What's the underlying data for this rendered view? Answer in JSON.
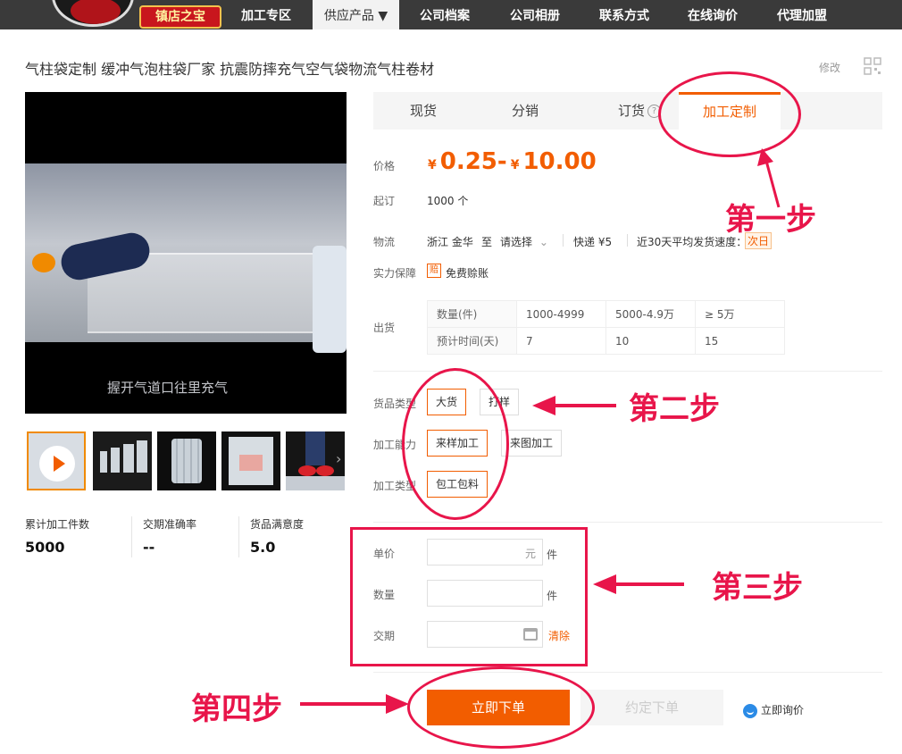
{
  "nav": {
    "badge": "镇店之宝",
    "items": [
      "加工专区",
      "供应产品 ▼",
      "公司档案",
      "公司相册",
      "联系方式",
      "在线询价",
      "代理加盟"
    ]
  },
  "product": {
    "title": "气柱袋定制 缓冲气泡柱袋厂家 抗震防摔充气空气袋物流气柱卷材",
    "edit": "修改",
    "video_caption": "握开气道口往里充气"
  },
  "stats": [
    {
      "label": "累计加工件数",
      "value": "5000"
    },
    {
      "label": "交期准确率",
      "value": "--"
    },
    {
      "label": "货品满意度",
      "value": "5.0"
    }
  ],
  "tabs": [
    "现货",
    "分销",
    "订货",
    "加工定制"
  ],
  "price": {
    "label": "价格",
    "low_sym": "¥",
    "low": "0.25",
    "dash": "-",
    "high_sym": "¥",
    "high": "10.00"
  },
  "moq": {
    "label": "起订",
    "value": "1000 个"
  },
  "logistics": {
    "label": "物流",
    "origin": "浙江 金华",
    "to": "至",
    "select": "请选择",
    "express": "快递 ¥5",
    "speed_label": "近30天平均发货速度：",
    "speed": "次日"
  },
  "guarantee": {
    "label": "实力保障",
    "icon_text": "赔",
    "text": "免费赊账"
  },
  "shipping": {
    "label": "出货",
    "rows": [
      [
        "数量(件)",
        "1000-4999",
        "5000-4.9万",
        "≥ 5万"
      ],
      [
        "预计时间(天)",
        "7",
        "10",
        "15"
      ]
    ]
  },
  "options": {
    "goods_type": {
      "label": "货品类型",
      "items": [
        "大货",
        "打样"
      ]
    },
    "capability": {
      "label": "加工能力",
      "items": [
        "来样加工",
        "来图加工"
      ]
    },
    "proc_type": {
      "label": "加工类型",
      "items": [
        "包工包料"
      ]
    }
  },
  "form": {
    "unit_price_label": "单价",
    "unit_price_suffix": "元",
    "per": "件",
    "qty_label": "数量",
    "date_label": "交期",
    "clear": "清除"
  },
  "actions": {
    "order": "立即下单",
    "reserve": "约定下单",
    "inquiry": "立即询价"
  },
  "annotations": {
    "step1": "第一步",
    "step2": "第二步",
    "step3": "第三步",
    "step4": "第四步"
  },
  "colors": {
    "accent": "#f25d00",
    "annotation": "#e8154a",
    "nav_bg": "#3a3a3a"
  }
}
